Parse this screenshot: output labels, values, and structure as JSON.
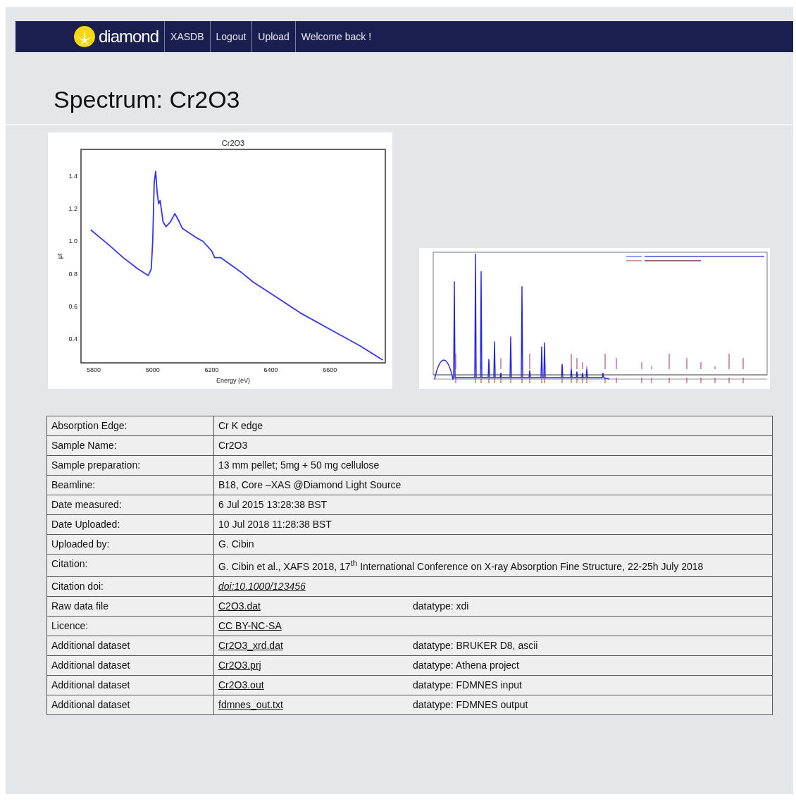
{
  "navbar": {
    "brand": "diamond",
    "items": [
      {
        "label": "XASDB"
      },
      {
        "label": "Logout"
      },
      {
        "label": "Upload"
      },
      {
        "label": "Welcome back !"
      }
    ]
  },
  "heading": "Spectrum: Cr2O3",
  "spectrum_chart": {
    "chart_data": {
      "type": "line",
      "title": "Cr2O3",
      "xlabel": "Energy (eV)",
      "ylabel": "μt",
      "xlim": [
        5757,
        6788
      ],
      "ylim": [
        0.253,
        1.565
      ],
      "xticks": [
        5800,
        6000,
        6200,
        6400,
        6600
      ],
      "yticks": [
        0.4,
        0.6,
        0.8,
        {
          "value": 1,
          "label": "1.0"
        },
        1.2,
        1.4
      ],
      "x": [
        5790,
        5850,
        5900,
        5950,
        5985,
        5995,
        6000,
        6005,
        6010,
        6015,
        6020,
        6025,
        6035,
        6045,
        6060,
        6075,
        6090,
        6100,
        6150,
        6170,
        6200,
        6210,
        6230,
        6300,
        6340,
        6400,
        6500,
        6600,
        6700,
        6780
      ],
      "series": [
        {
          "color": "#3333ff",
          "values": [
            1.07,
            0.98,
            0.9,
            0.83,
            0.79,
            0.83,
            1.0,
            1.36,
            1.43,
            1.3,
            1.23,
            1.25,
            1.12,
            1.09,
            1.12,
            1.17,
            1.12,
            1.08,
            1.02,
            1.0,
            0.94,
            0.9,
            0.9,
            0.81,
            0.75,
            0.68,
            0.56,
            0.46,
            0.36,
            0.27
          ]
        }
      ]
    }
  },
  "details": [
    {
      "label": "Absorption Edge:",
      "value": "Cr K edge",
      "kind": "text"
    },
    {
      "label": "Sample Name:",
      "value": "Cr2O3",
      "kind": "text"
    },
    {
      "label": "Sample preparation:",
      "value": "13 mm pellet; 5mg + 50 mg cellulose",
      "kind": "text"
    },
    {
      "label": "Beamline:",
      "value": "B18, Core –XAS @Diamond Light Source",
      "kind": "text"
    },
    {
      "label": "Date measured:",
      "value": "6 Jul 2015 13:28:38 BST",
      "kind": "text"
    },
    {
      "label": "Date Uploaded:",
      "value": "10 Jul 2018 11:28:38 BST",
      "kind": "text"
    },
    {
      "label": "Uploaded by:",
      "value": "G. Cibin",
      "kind": "text"
    },
    {
      "label": "Citation:",
      "value": "G. Cibin et al., XAFS 2018, 17$^{th}$ International Conference on X-ray Absorption Fine Structure, 22-25h July 2018",
      "kind": "text"
    },
    {
      "label": "Citation doi:",
      "value": "doi:10.1000/123456",
      "kind": "doi"
    },
    {
      "label": "Raw data file",
      "value": "C2O3.dat",
      "kind": "link",
      "datatype": "datatype: xdi"
    },
    {
      "label": "Licence:",
      "value": "CC BY-NC-SA",
      "kind": "link"
    },
    {
      "label": "Additional dataset",
      "value": "Cr2O3_xrd.dat",
      "kind": "link",
      "datatype": "datatype: BRUKER D8, ascii"
    },
    {
      "label": "Additional dataset",
      "value": "Cr2O3.prj",
      "kind": "link",
      "datatype": "datatype: Athena project"
    },
    {
      "label": "Additional dataset",
      "value": "Cr2O3.out",
      "kind": "link",
      "datatype": "datatype: FDMNES input"
    },
    {
      "label": "Additional dataset",
      "value": "fdmnes_out.txt",
      "kind": "link",
      "datatype": "datatype: FDMNES output"
    }
  ]
}
